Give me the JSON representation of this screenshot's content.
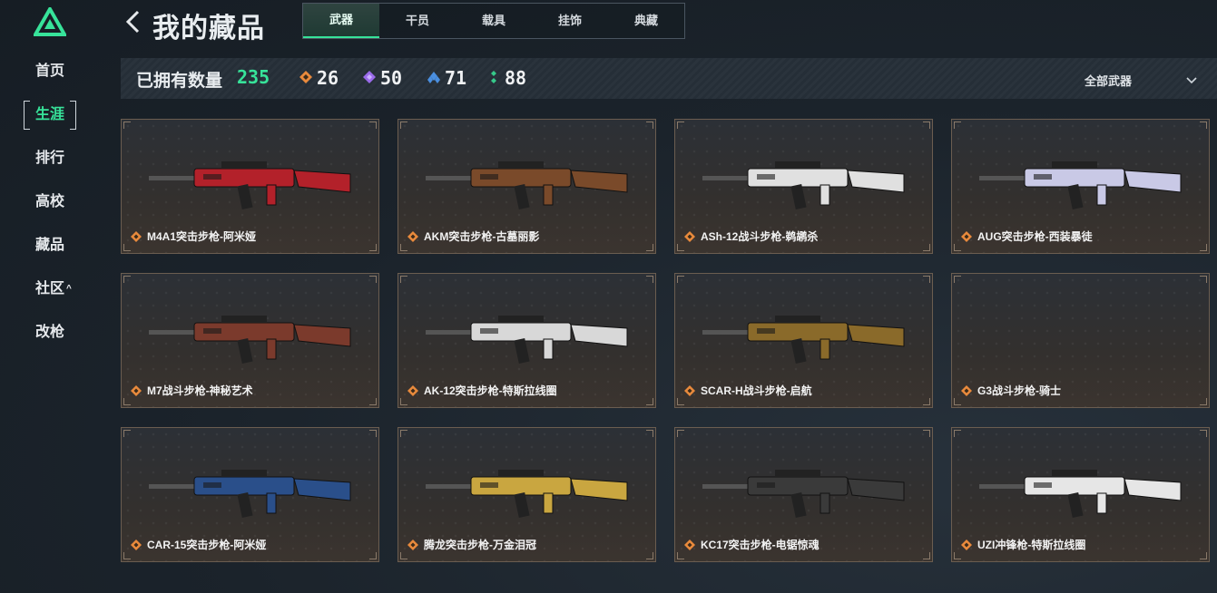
{
  "header": {
    "title": "我的藏品",
    "tabs": [
      "武器",
      "干员",
      "载具",
      "挂饰",
      "典藏"
    ]
  },
  "sidebar": {
    "items": [
      {
        "label": "首页"
      },
      {
        "label": "生涯"
      },
      {
        "label": "排行"
      },
      {
        "label": "高校"
      },
      {
        "label": "藏品"
      },
      {
        "label": "社区",
        "caret": "^"
      },
      {
        "label": "改枪"
      }
    ]
  },
  "stats": {
    "owned_label": "已拥有数量",
    "owned_count": "235",
    "tiers": [
      {
        "icon": "orange-diamond-icon",
        "color": "#e98a3c",
        "value": "26"
      },
      {
        "icon": "purple-diamond-icon",
        "color": "#9a6bea",
        "value": "50"
      },
      {
        "icon": "blue-diamond-icon",
        "color": "#4a8fe0",
        "value": "71"
      },
      {
        "icon": "green-diamond-icon",
        "color": "#36c98a",
        "value": "88"
      }
    ],
    "filter_label": "全部武器"
  },
  "items": [
    {
      "name": "M4A1突击步枪-阿米娅",
      "accent": "#b3212a"
    },
    {
      "name": "AKM突击步枪-古墓丽影",
      "accent": "#7a4a2a"
    },
    {
      "name": "ASh-12战斗步枪-鹈鹕杀",
      "accent": "#e0e0e0"
    },
    {
      "name": "AUG突击步枪-西装暴徒",
      "accent": "#c9c9e6"
    },
    {
      "name": "M7战斗步枪-神秘艺术",
      "accent": "#7b3a2c"
    },
    {
      "name": "AK-12突击步枪-特斯拉线圈",
      "accent": "#d8d8d8"
    },
    {
      "name": "SCAR-H战斗步枪-启航",
      "accent": "#8a6a2a"
    },
    {
      "name": "G3战斗步枪-骑士",
      "accent": ""
    },
    {
      "name": "CAR-15突击步枪-阿米娅",
      "accent": "#2a4f8a"
    },
    {
      "name": "腾龙突击步枪-万金泪冠",
      "accent": "#c9a640"
    },
    {
      "name": "KC17突击步枪-电锯惊魂",
      "accent": "#3a3a3a"
    },
    {
      "name": "UZI冲锋枪-特斯拉线圈",
      "accent": "#e6e6e6"
    }
  ],
  "colors": {
    "accent_green": "#37e39a",
    "rarity_orange": "#e98a3c",
    "card_border": "#6b5d50"
  }
}
